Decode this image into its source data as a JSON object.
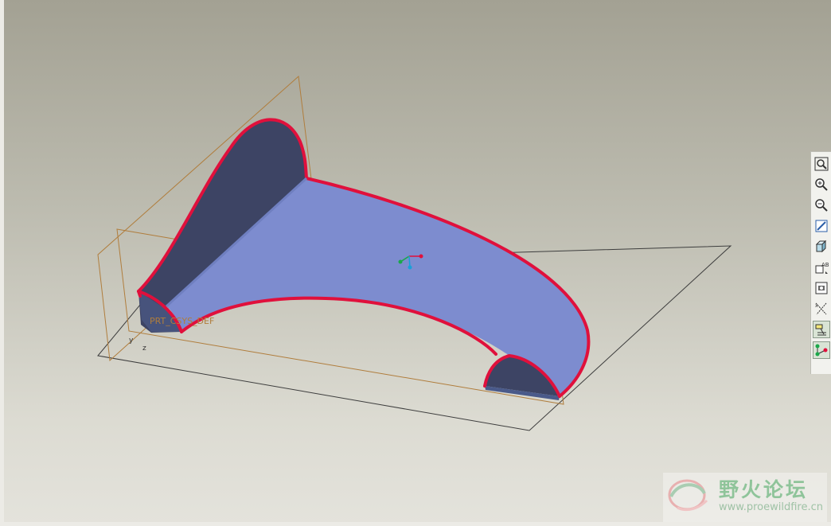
{
  "viewport": {
    "background_top": "#a3a193",
    "background_bottom": "#e4e3dc"
  },
  "model": {
    "csys_label": "PRT_CSYS_DEF",
    "axis_labels": {
      "y": "y",
      "z": "z"
    },
    "face_color": "#7d8ccf",
    "side_color": "#3d4464",
    "edge_color": "#e0103c",
    "datum_plane_color": "#b07d3c"
  },
  "toolbar": {
    "buttons": [
      {
        "name": "refit",
        "icon": "refit-icon"
      },
      {
        "name": "zoom-in",
        "icon": "zoom-in-icon"
      },
      {
        "name": "zoom-out",
        "icon": "zoom-out-icon"
      },
      {
        "name": "repaint",
        "icon": "repaint-icon"
      },
      {
        "name": "display-style",
        "icon": "shaded-cube-icon"
      },
      {
        "name": "saved-views",
        "icon": "saved-views-icon"
      },
      {
        "name": "layers",
        "icon": "layers-icon"
      },
      {
        "name": "datum-axes",
        "icon": "datum-axes-icon"
      },
      {
        "name": "datum-points",
        "icon": "datum-points-icon"
      },
      {
        "name": "csys-display",
        "icon": "csys-icon"
      }
    ]
  },
  "watermark": {
    "title": "野火论坛",
    "url": "www.proewildfire.cn"
  }
}
